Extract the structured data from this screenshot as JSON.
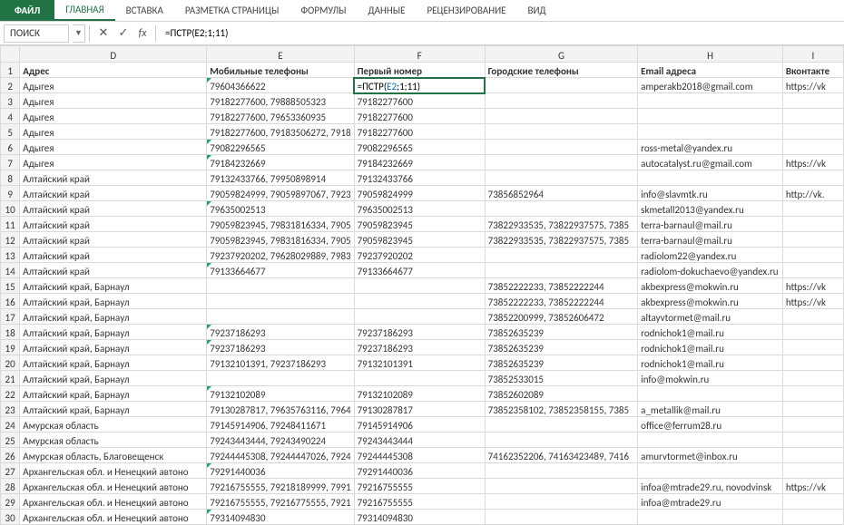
{
  "ribbon": {
    "file": "ФАЙЛ",
    "tabs": [
      "ГЛАВНАЯ",
      "ВСТАВКА",
      "РАЗМЕТКА СТРАНИЦЫ",
      "ФОРМУЛЫ",
      "ДАННЫЕ",
      "РЕЦЕНЗИРОВАНИЕ",
      "ВИД"
    ]
  },
  "name_box": "ПОИСК",
  "formula": "=ПСТР(E2;1;11)",
  "formula_prefix": "=ПСТР(",
  "formula_ref": "E2",
  "formula_suffix": ";1;11)",
  "columns": [
    "D",
    "E",
    "F",
    "G",
    "H",
    "I"
  ],
  "headers": {
    "D": "Адрес",
    "E": "Мобильные телефоны",
    "F": "Первый номер",
    "G": "Городские телефоны",
    "H": "Email адреса",
    "I": "Вконтакте"
  },
  "rows": [
    {
      "n": 1,
      "D": "Адрес",
      "E": "Мобильные телефоны",
      "F": "Первый номер",
      "G": "Городские телефоны",
      "H": "Email адреса",
      "I": "Вконтакте",
      "hdr": true
    },
    {
      "n": 2,
      "D": "Адыгея",
      "E": "79604366622",
      "F_formula": true,
      "G": "",
      "H": "amperakb2018@gmail.com",
      "I": "https://vk",
      "tri": true
    },
    {
      "n": 3,
      "D": "Адыгея",
      "E": "79182277600, 79888505323",
      "F": "79182277600",
      "G": "",
      "H": "",
      "I": ""
    },
    {
      "n": 4,
      "D": "Адыгея",
      "E": "79182277600, 79653360935",
      "F": "79182277600",
      "G": "",
      "H": "",
      "I": ""
    },
    {
      "n": 5,
      "D": "Адыгея",
      "E": "79182277600, 79183506272, 7918",
      "F": "79182277600",
      "G": "",
      "H": "",
      "I": ""
    },
    {
      "n": 6,
      "D": "Адыгея",
      "E": "79082296565",
      "F": "79082296565",
      "G": "",
      "H": "ross-metal@yandex.ru",
      "I": "",
      "tri": true
    },
    {
      "n": 7,
      "D": "Адыгея",
      "E": "79184232669",
      "F": "79184232669",
      "G": "",
      "H": "autocatalyst.ru@gmail.com",
      "I": "https://vk",
      "tri": true
    },
    {
      "n": 8,
      "D": "Алтайский край",
      "E": "79132433766, 79950898914",
      "F": "79132433766",
      "G": "",
      "H": "",
      "I": ""
    },
    {
      "n": 9,
      "D": "Алтайский край",
      "E": "79059824999, 79059897067, 7923",
      "F": "79059824999",
      "G": "73856852964",
      "H": "info@slavmtk.ru",
      "I": "http://vk."
    },
    {
      "n": 10,
      "D": "Алтайский край",
      "E": "79635002513",
      "F": "79635002513",
      "G": "",
      "H": "skmetall2013@yandex.ru",
      "I": "",
      "tri": true
    },
    {
      "n": 11,
      "D": "Алтайский край",
      "E": "79059823945, 79831816334, 7905",
      "F": "79059823945",
      "G": "73822933535, 73822937575, 7385",
      "H": "terra-barnaul@mail.ru",
      "I": ""
    },
    {
      "n": 12,
      "D": "Алтайский край",
      "E": "79059823945, 79831816334, 7905",
      "F": "79059823945",
      "G": "73822933535, 73822937575, 7385",
      "H": "terra-barnaul@mail.ru",
      "I": ""
    },
    {
      "n": 13,
      "D": "Алтайский край",
      "E": "79237920202, 79628029889, 7983",
      "F": "79237920202",
      "G": "",
      "H": "radiolom22@yandex.ru",
      "I": ""
    },
    {
      "n": 14,
      "D": "Алтайский край",
      "E": "79133664677",
      "F": "79133664677",
      "G": "",
      "H": "radiolom-dokuchaevo@yandex.ru",
      "I": "",
      "tri": true
    },
    {
      "n": 15,
      "D": "Алтайский край, Барнаул",
      "E": "",
      "F": "",
      "G": "73852222233, 73852222244",
      "H": "akbexpress@mokwin.ru",
      "I": "https://vk"
    },
    {
      "n": 16,
      "D": "Алтайский край, Барнаул",
      "E": "",
      "F": "",
      "G": "73852222233, 73852222244",
      "H": "akbexpress@mokwin.ru",
      "I": "https://vk"
    },
    {
      "n": 17,
      "D": "Алтайский край, Барнаул",
      "E": "",
      "F": "",
      "G": "73852200999, 73852606472",
      "H": "altayvtormet@mail.ru",
      "I": ""
    },
    {
      "n": 18,
      "D": "Алтайский край, Барнаул",
      "E": "79237186293",
      "F": "79237186293",
      "G": "73852635239",
      "H": "rodnichok1@mail.ru",
      "I": "",
      "tri": true
    },
    {
      "n": 19,
      "D": "Алтайский край, Барнаул",
      "E": "79237186293",
      "F": "79237186293",
      "G": "73852635239",
      "H": "rodnichok1@mail.ru",
      "I": "",
      "tri": true
    },
    {
      "n": 20,
      "D": "Алтайский край, Барнаул",
      "E": "79132101391, 79237186293",
      "F": "79132101391",
      "G": "73852635239",
      "H": "rodnichok1@mail.ru",
      "I": ""
    },
    {
      "n": 21,
      "D": "Алтайский край, Барнаул",
      "E": "",
      "F": "",
      "G": "73852533015",
      "H": "info@mokwin.ru",
      "I": ""
    },
    {
      "n": 22,
      "D": "Алтайский край, Барнаул",
      "E": "79132102089",
      "F": "79132102089",
      "G": "73852602089",
      "H": "",
      "I": "",
      "tri": true
    },
    {
      "n": 23,
      "D": "Алтайский край, Барнаул",
      "E": "79130287817, 79635763116, 7964",
      "F": "79130287817",
      "G": "73852358102, 73852358155, 7385",
      "H": "a_metallik@mail.ru",
      "I": ""
    },
    {
      "n": 24,
      "D": "Амурская область",
      "E": "79145914906, 79248411671",
      "F": "79145914906",
      "G": "",
      "H": "office@ferrum28.ru",
      "I": ""
    },
    {
      "n": 25,
      "D": "Амурская область",
      "E": "79243443444, 79243490224",
      "F": "79243443444",
      "G": "",
      "H": "",
      "I": ""
    },
    {
      "n": 26,
      "D": "Амурская область, Благовещенск",
      "E": "79244445308, 79244447026, 7924",
      "F": "79244445308",
      "G": "74162352206, 74163423489, 7416",
      "H": "amurvtormet@inbox.ru",
      "I": ""
    },
    {
      "n": 27,
      "D": "Архангельская обл. и Ненецкий автоно",
      "E": "79291440036",
      "F": "79291440036",
      "G": "",
      "H": "",
      "I": "",
      "tri": true
    },
    {
      "n": 28,
      "D": "Архангельская обл. и Ненецкий автоно",
      "E": "79216755555, 79218189999, 7991",
      "F": "79216755555",
      "G": "",
      "H": "infoa@mtrade29.ru, novodvinsk",
      "I": "https://vk"
    },
    {
      "n": 29,
      "D": "Архангельская обл. и Ненецкий автоно",
      "E": "79216755555, 79216775555, 7921",
      "F": "79216755555",
      "G": "",
      "H": "infoa@mtrade29.ru",
      "I": ""
    },
    {
      "n": 30,
      "D": "Архангельская обл. и Ненецкий автоно",
      "E": "79314094830",
      "F": "79314094830",
      "G": "",
      "H": "",
      "I": "",
      "tri": true
    }
  ]
}
